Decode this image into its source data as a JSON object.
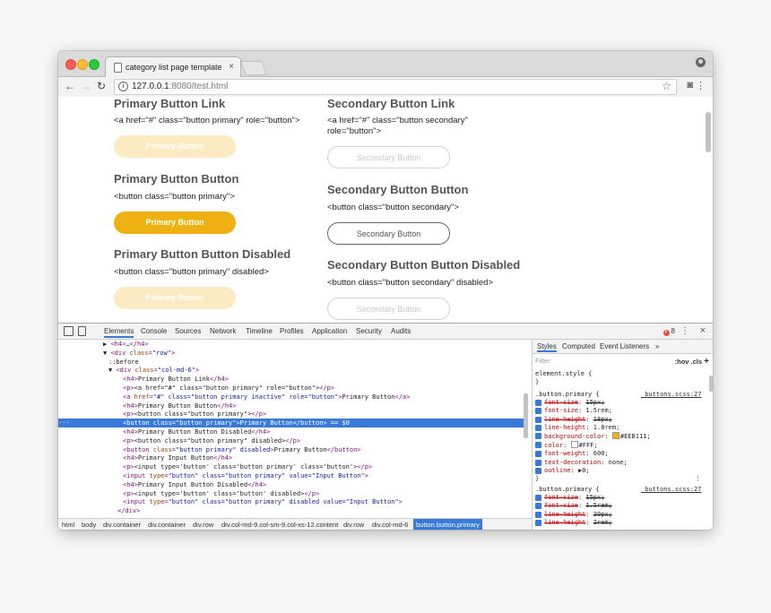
{
  "browser": {
    "tab_title": "category list page template",
    "tab_close": "×",
    "url_host": "127.0.0.1",
    "url_port": ":8080",
    "url_path": "/test.html",
    "info_glyph": "i"
  },
  "page": {
    "left": {
      "h_link": "Primary Button Link",
      "code_link": "<a href=\"#\" class=\"button primary\" role=\"button\">",
      "btn_link": "Primary Button",
      "h_button": "Primary Button Button",
      "code_button": "<button class=\"button primary\">",
      "btn_button": "Primary Button",
      "h_disabled": "Primary Button Button Disabled",
      "code_disabled": "<button class=\"button primary\" disabled>",
      "btn_disabled": "Primary Button"
    },
    "right": {
      "h_link": "Secondary Button Link",
      "code_link_1": "<a href=\"#\" class=\"button secondary\"",
      "code_link_2": "role=\"button\">",
      "btn_link": "Secondary Button",
      "h_button": "Secondary Button Button",
      "code_button": "<button class=\"button secondary\">",
      "btn_button": "Secondary Button",
      "h_disabled": "Secondary Button Button Disabled",
      "code_disabled": "<button class=\"button secondary\" disabled>",
      "btn_disabled": "Secondary Button"
    }
  },
  "devtools": {
    "tabs": [
      "Elements",
      "Console",
      "Sources",
      "Network",
      "Timeline",
      "Profiles",
      "Application",
      "Security",
      "Audits"
    ],
    "error_count": "8",
    "dom_lines": [
      {
        "prefix": "▶ ",
        "tag1": "<h4>",
        "text": "…",
        "tag2": "</h4>"
      },
      {
        "prefix": "▼ ",
        "tag1": "<div ",
        "attr": "class",
        "val": "\"row\"",
        "tag2": ">"
      },
      {
        "prefix": "",
        "tag1": "",
        "text": "::before",
        "tag2": ""
      },
      {
        "prefix": "▼ ",
        "tag1": "<div ",
        "attr": "class",
        "val": "\"col-md-6\"",
        "tag2": ">"
      },
      {
        "prefix": "",
        "tag1": "<h4>",
        "text": "Primary Button Link",
        "tag2": "</h4>"
      },
      {
        "prefix": "",
        "tag1": "<p>",
        "text": "<a href=\"#\" class=\"button primary\" role=\"button\">",
        "tag2": "</p>"
      },
      {
        "prefix": "",
        "tag1": "<a ",
        "attr": "href",
        "val": "\"#\" class=\"button primary inactive\" role=\"button\"",
        "tag2": ">",
        "text2": "Primary Button",
        "tag3": "</a>"
      },
      {
        "prefix": "",
        "tag1": "<h4>",
        "text": "Primary Button Button",
        "tag2": "</h4>"
      },
      {
        "prefix": "",
        "tag1": "<p>",
        "text": "<button class=\"button primary\">",
        "tag2": "</p>"
      },
      {
        "prefix": "",
        "tag1": "<button ",
        "attr": "class",
        "val": "\"button primary\"",
        "tag2": ">",
        "text2": "Primary Button",
        "tag3": "</button>",
        "suffix": " == $0"
      },
      {
        "prefix": "",
        "tag1": "<h4>",
        "text": "Primary Button Button Disabled",
        "tag2": "</h4>"
      },
      {
        "prefix": "",
        "tag1": "<p>",
        "text": "<button class=\"button primary\" disabled>",
        "tag2": "</p>"
      },
      {
        "prefix": "",
        "tag1": "<button ",
        "attr": "class",
        "val": "\"button primary\" disabled",
        "tag2": ">",
        "text2": "Primary Button",
        "tag3": "</button>"
      },
      {
        "prefix": "",
        "tag1": "<h4>",
        "text": "Primary Input Button",
        "tag2": "</h4>"
      },
      {
        "prefix": "",
        "tag1": "<p>",
        "text": "<input type='button' class='button primary' class='button'>",
        "tag2": "</p>"
      },
      {
        "prefix": "",
        "tag1": "<input ",
        "attr": "type",
        "val": "\"button\" class=\"button primary\" value=\"Input Button\"",
        "tag2": ">"
      },
      {
        "prefix": "",
        "tag1": "<h4>",
        "text": "Primary Input Button Disabled",
        "tag2": "</h4>"
      },
      {
        "prefix": "",
        "tag1": "<p>",
        "text": "<input type='button' class='button' disabled>",
        "tag2": "</p>"
      },
      {
        "prefix": "",
        "tag1": "<input ",
        "attr": "type",
        "val": "\"button\" class=\"button primary\" disabled value=\"Input Button\"",
        "tag2": ">"
      },
      {
        "prefix": "",
        "tag1": "</div>",
        "text": "",
        "tag2": ""
      }
    ],
    "breadcrumbs": [
      "html",
      "body",
      "div.container",
      "div.container",
      "div.row",
      "div.col-md-9.col-sm-9.col-xs-12.content",
      "div.row",
      "div.col-md-6",
      "button.button.primary"
    ],
    "styles_tabs": [
      "Styles",
      "Computed",
      "Event Listeners",
      "»"
    ],
    "filter_placeholder": "Filter",
    "hov_cls": ":hov .cls",
    "add_rule": "+",
    "element_style": "element.style {",
    "rule1": {
      "selector": ".button.primary {",
      "source": "_buttons.scss:27",
      "props": [
        {
          "name": "font-size",
          "value": "15px;",
          "strike": true
        },
        {
          "name": "font-size",
          "value": "1.5rem;",
          "strike": false
        },
        {
          "name": "line-height",
          "value": "18px;",
          "strike": true
        },
        {
          "name": "line-height",
          "value": "1.8rem;",
          "strike": false
        },
        {
          "name": "background-color",
          "value": "#EEB111;",
          "strike": false,
          "swatch": "#eeb111"
        },
        {
          "name": "color",
          "value": "#FFF;",
          "strike": false,
          "swatch": "#ffffff"
        },
        {
          "name": "font-weight",
          "value": "600;",
          "strike": false
        },
        {
          "name": "text-decoration",
          "value": "none;",
          "strike": false
        },
        {
          "name": "outline",
          "value": "▶0;",
          "strike": false
        }
      ]
    },
    "rule2": {
      "selector": ".button.primary {",
      "source": "_buttons.scss:27",
      "props": [
        {
          "name": "font-size",
          "value": "15px;",
          "strike": true
        },
        {
          "name": "font-size",
          "value": "1.5rem;",
          "strike": true
        },
        {
          "name": "line-height",
          "value": "20px;",
          "strike": true
        },
        {
          "name": "line-height",
          "value": "2rem;",
          "strike": true
        }
      ]
    }
  },
  "colors": {
    "primary": "#eeb111",
    "selection": "#3879d9"
  }
}
